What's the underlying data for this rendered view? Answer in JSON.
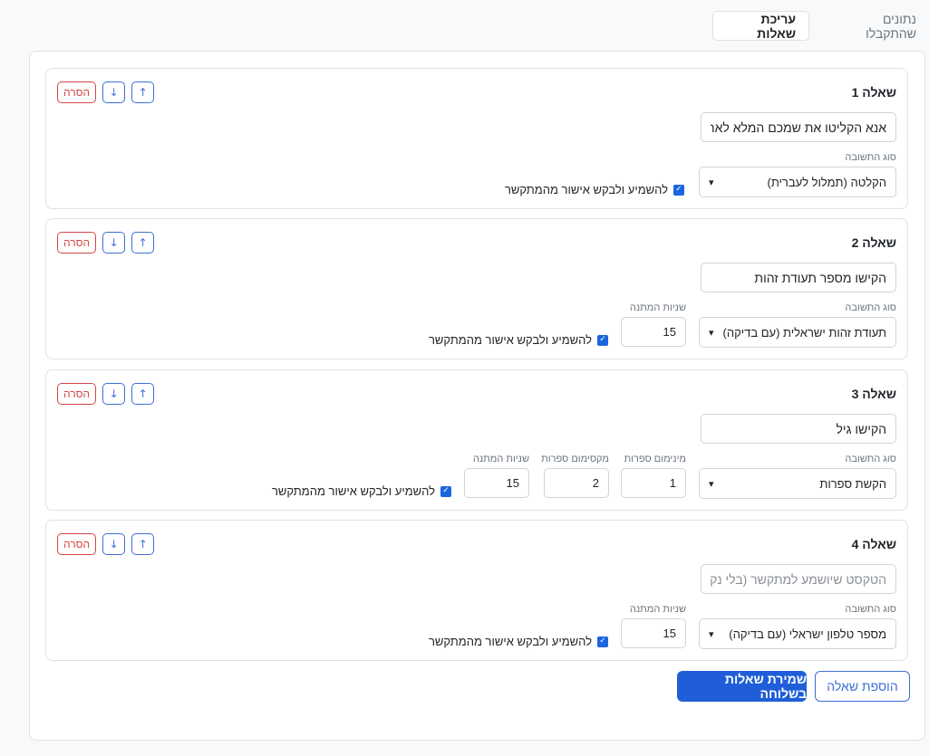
{
  "tabs": {
    "received": "נתונים שהתקבלו",
    "edit": "עריכת שאלות"
  },
  "common": {
    "remove": "הסרה",
    "up": "↑",
    "down": "↓",
    "answer_type_label": "סוג התשובה",
    "wait_seconds_label": "שניות המתנה",
    "min_digits_label": "מינימום ספרות",
    "max_digits_label": "מקסימום ספרות",
    "confirm_label": "להשמיע ולבקש אישור מהמתקשר",
    "caret": "▾",
    "checkmark": "✓"
  },
  "questions": [
    {
      "title": "שאלה 1",
      "text": "אנא הקליטו את שמכם המלא לאחר הצפצוף",
      "placeholder": "",
      "answer_type": "הקלטה (תמלול לעברית)",
      "confirm": true
    },
    {
      "title": "שאלה 2",
      "text": "הקישו מספר תעודת זהות",
      "placeholder": "",
      "answer_type": "תעודת זהות ישראלית (עם בדיקה)",
      "wait_seconds": "15",
      "confirm": true
    },
    {
      "title": "שאלה 3",
      "text": "הקישו גיל",
      "placeholder": "",
      "answer_type": "הקשת ספרות",
      "min_digits": "1",
      "max_digits": "2",
      "wait_seconds": "15",
      "confirm": true
    },
    {
      "title": "שאלה 4",
      "text": "",
      "placeholder": "הטקסט שיושמע למתקשר (בלי נקודות)",
      "answer_type": "מספר טלפון ישראלי (עם בדיקה)",
      "wait_seconds": "15",
      "confirm": true
    }
  ],
  "actions": {
    "add_question": "הוספת שאלה",
    "save_questions": "שמירת שאלות בשלוחה"
  },
  "colors": {
    "primary": "#1f5ed8",
    "outline_blue": "#3d6fd6",
    "danger": "#d64545"
  }
}
